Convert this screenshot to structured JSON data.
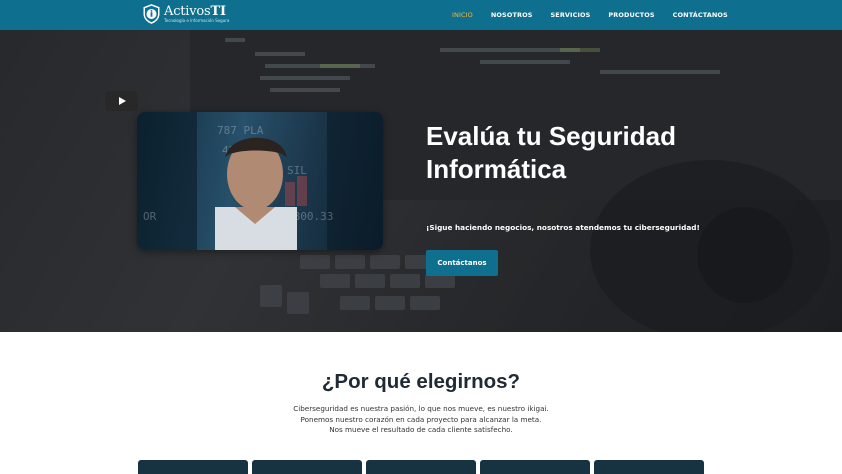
{
  "header": {
    "logo_name_prefix": "Activos",
    "logo_name_suffix": "TI",
    "logo_tagline": "Tecnología e Información Segura",
    "nav": [
      {
        "label": "INICIO",
        "active": true
      },
      {
        "label": "NOSOTROS",
        "active": false
      },
      {
        "label": "SERVICIOS",
        "active": false
      },
      {
        "label": "PRODUCTOS",
        "active": false
      },
      {
        "label": "CONTÁCTANOS",
        "active": false
      }
    ]
  },
  "hero": {
    "title_line1": "Evalúa tu Seguridad",
    "title_line2": "Informática",
    "subtitle": "¡Sigue haciendo negocios, nosotros atendemos tu ciberseguridad!",
    "cta_label": "Contáctanos",
    "video_icon": "play-icon"
  },
  "why": {
    "title": "¿Por qué elegirnos?",
    "lines": [
      "Ciberseguridad es nuestra pasión, lo que nos mueve, es nuestro ikigai.",
      "Ponemos nuestro corazón en cada proyecto para alcanzar la meta.",
      "Nos mueve el resultado de cada cliente satisfecho."
    ]
  },
  "colors": {
    "brand": "#0e6f8f",
    "active_nav": "#f4b93f",
    "card": "#173240"
  }
}
